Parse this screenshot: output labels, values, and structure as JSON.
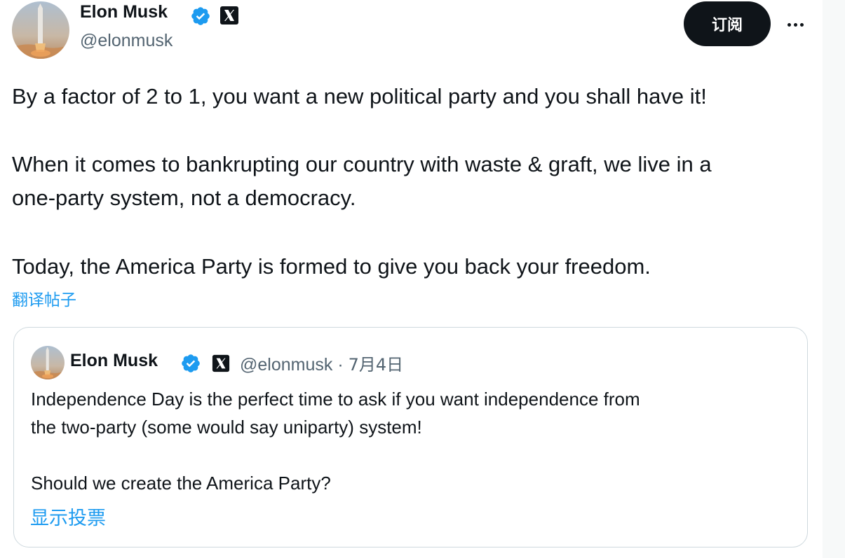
{
  "tweet": {
    "author": {
      "name": "Elon Musk",
      "handle": "@elonmusk",
      "avatar_icon": "rocket-launch-avatar",
      "verified_icon": "verified-badge-icon",
      "affiliation_icon": "x-logo-badge-icon"
    },
    "subscribe_label": "订阅",
    "more_icon": "more-dots-icon",
    "paragraphs": [
      [
        "By a factor of 2 to 1, you want a new political party and you shall have it!"
      ],
      [
        "When it comes to bankrupting our country with waste & graft, we live in a",
        "one-party system, not a democracy."
      ],
      [
        "Today, the America Party is formed to give you back your freedom."
      ]
    ],
    "translate_label": "翻译帖子"
  },
  "quote": {
    "author": {
      "name": "Elon Musk",
      "handle": "@elonmusk",
      "separator": "·",
      "date": "7月4日"
    },
    "lines": [
      "Independence Day is the perfect time to ask if you want independence from",
      "the two-party (some would say uniparty) system!",
      "Should we create the America Party?"
    ],
    "show_poll_label": "显示投票"
  },
  "colors": {
    "accent": "#1d9bf0",
    "text": "#0f1419",
    "secondary_text": "#536471",
    "border": "#cfd9de",
    "button_bg": "#0f1419",
    "rail_bg": "#f7f9f9"
  }
}
